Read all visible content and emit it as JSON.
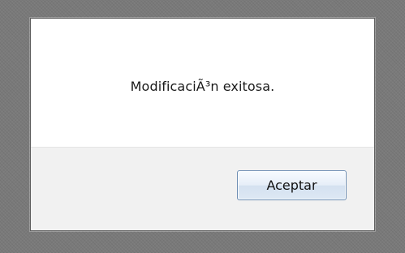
{
  "dialog": {
    "message": "ModificaciÃ³n exitosa.",
    "ok_label": "Aceptar"
  }
}
